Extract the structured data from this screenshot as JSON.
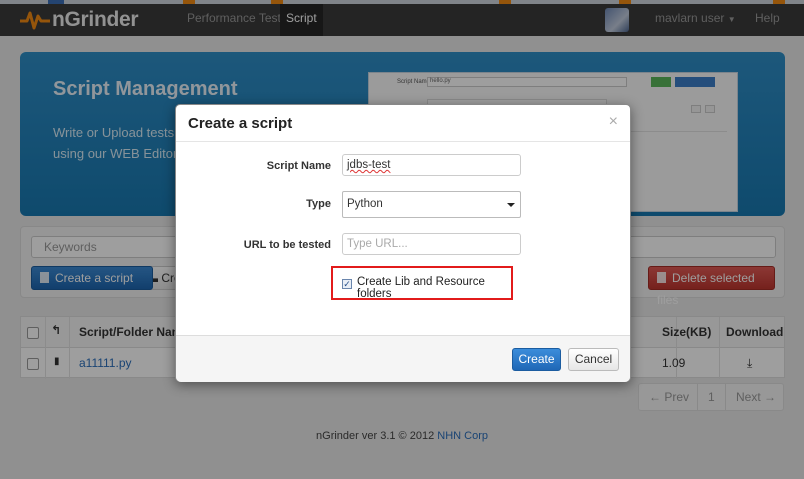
{
  "navbar": {
    "brand": "nGrinder",
    "links": [
      "Performance Test",
      "Script"
    ],
    "user": "mavlarn user",
    "help": "Help"
  },
  "hero": {
    "title": "Script Management",
    "text_line1": "Write or Upload tests s",
    "text_line2": "using our WEB Editor o",
    "preview_label": "Script Name",
    "preview_value": "hello.py"
  },
  "toolbar": {
    "search_placeholder": "Keywords",
    "create_script": "Create a script",
    "create_folder": "Cre",
    "delete_selected": "Delete selected files"
  },
  "table": {
    "headers": {
      "name": "Script/Folder Name",
      "size": "Size(KB)",
      "download": "Download"
    },
    "rows": [
      {
        "name": "a11111.py",
        "size": "1.09"
      }
    ]
  },
  "pager": {
    "prev": "← Prev",
    "page": "1",
    "next": "Next →"
  },
  "footer": {
    "text": "nGrinder ver 3.1 © 2012 ",
    "link": "NHN Corp"
  },
  "modal": {
    "title": "Create a script",
    "close": "×",
    "fields": {
      "script_name_label": "Script Name",
      "script_name_value": "jdbs-test",
      "type_label": "Type",
      "type_value": "Python",
      "url_label": "URL to be tested",
      "url_placeholder": "Type URL..."
    },
    "checkbox": {
      "label": "Create Lib and Resource folders",
      "checked": true
    },
    "buttons": {
      "create": "Create",
      "cancel": "Cancel"
    }
  },
  "colors": {
    "highlight": "#e21b1b",
    "primary": "#1f67b6",
    "danger": "#bd362f"
  }
}
